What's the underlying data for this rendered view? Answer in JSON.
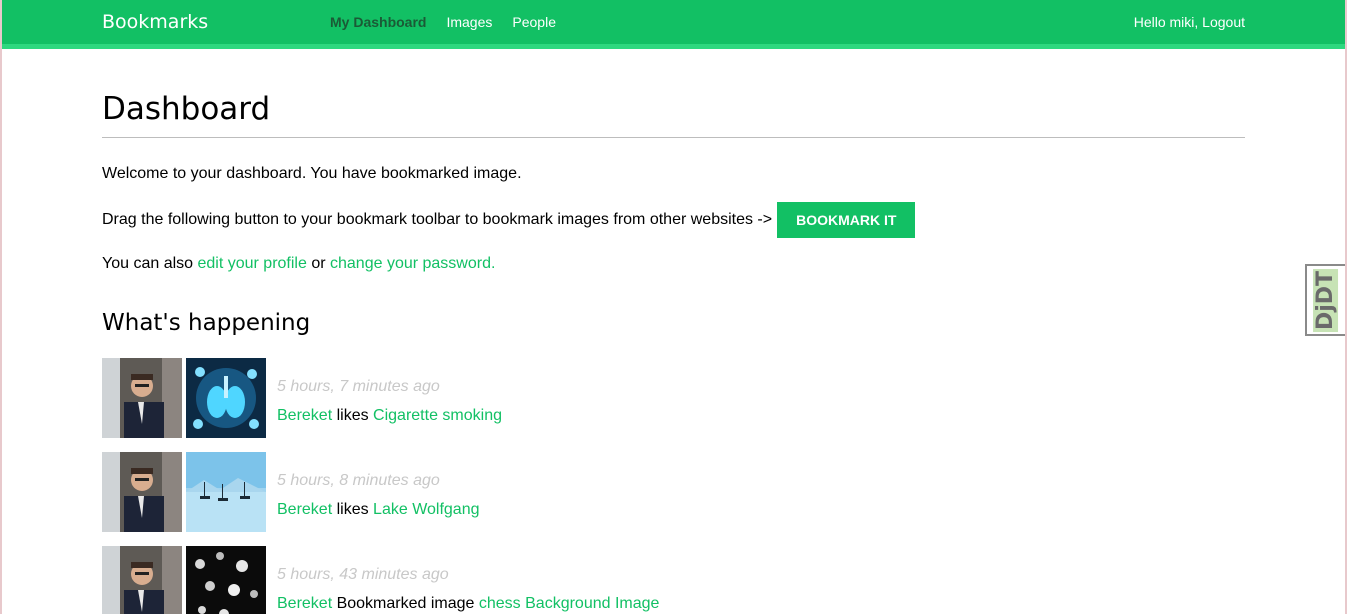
{
  "header": {
    "logo": "Bookmarks",
    "nav": [
      {
        "label": "My Dashboard",
        "active": true
      },
      {
        "label": "Images",
        "active": false
      },
      {
        "label": "People",
        "active": false
      }
    ],
    "greeting": "Hello miki, ",
    "logout": "Logout"
  },
  "main": {
    "title": "Dashboard",
    "welcome": "Welcome to your dashboard. You have bookmarked image.",
    "drag_text": "Drag the following button to your bookmark toolbar to bookmark images from other websites ->",
    "bookmark_button": "BOOKMARK IT",
    "also_prefix": "You can also ",
    "edit_profile": "edit your profile",
    "or": " or ",
    "change_password": "change your password.",
    "section_title": "What's happening"
  },
  "actions": [
    {
      "time": "5 hours, 7 minutes ago",
      "user": "Bereket",
      "verb": " likes ",
      "target": "Cigarette smoking"
    },
    {
      "time": "5 hours, 8 minutes ago",
      "user": "Bereket",
      "verb": " likes ",
      "target": "Lake Wolfgang"
    },
    {
      "time": "5 hours, 43 minutes ago",
      "user": "Bereket",
      "verb": " Bookmarked image ",
      "target": "chess Background Image"
    }
  ],
  "debug_toolbar": {
    "label": "DjDT"
  },
  "colors": {
    "brand": "#12c064",
    "link": "#12c064",
    "muted": "#c8c8c8"
  }
}
